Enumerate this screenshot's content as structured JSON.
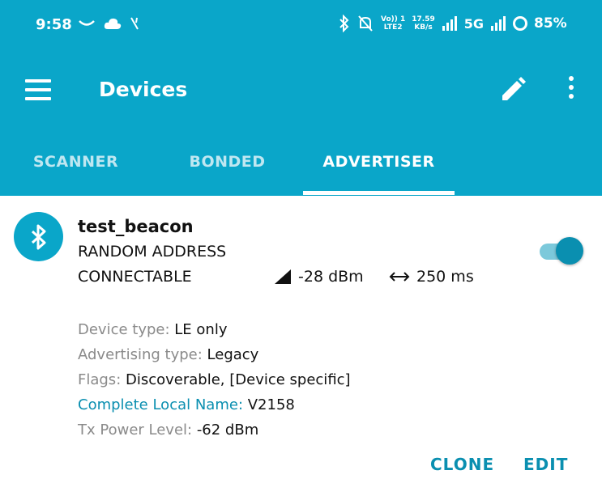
{
  "status_bar": {
    "time": "9:58",
    "network_label": "5G",
    "volte_label": "Vo)) 1\nLTE2",
    "speed_label": "17.59\nKB/s",
    "battery": "85%"
  },
  "toolbar": {
    "title": "Devices"
  },
  "tabs": [
    {
      "label": "SCANNER",
      "active": false
    },
    {
      "label": "BONDED",
      "active": false
    },
    {
      "label": "ADVERTISER",
      "active": true
    }
  ],
  "device": {
    "name": "test_beacon",
    "address_type": "RANDOM ADDRESS",
    "connectable": "CONNECTABLE",
    "tx_power": "-28 dBm",
    "interval": "250 ms",
    "enabled": true
  },
  "details": [
    {
      "label": "Device type: ",
      "value": "LE only",
      "accent": false
    },
    {
      "label": "Advertising type: ",
      "value": "Legacy",
      "accent": false
    },
    {
      "label": "Flags: ",
      "value": "Discoverable, [Device specific]",
      "accent": false
    },
    {
      "label": "Complete Local Name: ",
      "value": "V2158",
      "accent": true
    },
    {
      "label": "Tx Power Level: ",
      "value": "-62 dBm",
      "accent": false
    }
  ],
  "actions": {
    "clone_label": "CLONE",
    "edit_label": "EDIT"
  },
  "colors": {
    "primary": "#0aa6c9",
    "accent": "#0a8fb0"
  }
}
